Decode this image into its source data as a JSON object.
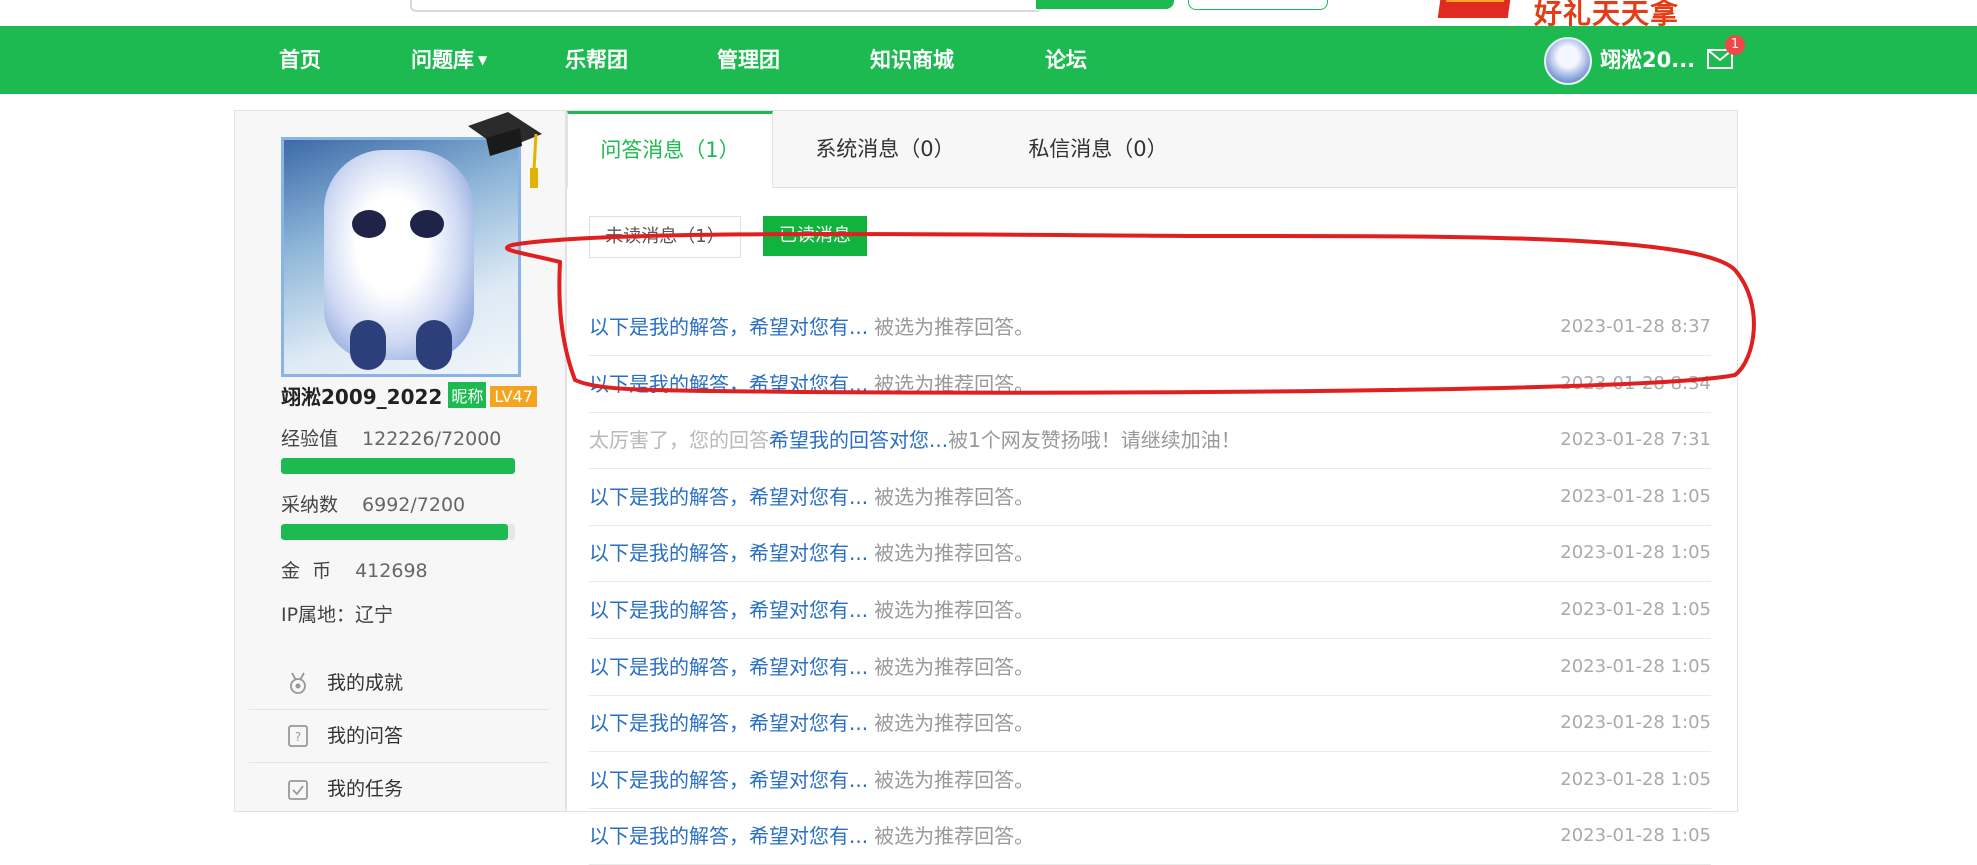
{
  "header": {
    "promo_text": "好礼天天拿"
  },
  "nav": {
    "items": [
      {
        "label": "首页"
      },
      {
        "label": "问题库"
      },
      {
        "label": "乐帮团"
      },
      {
        "label": "管理团"
      },
      {
        "label": "知识商城"
      },
      {
        "label": "论坛"
      }
    ],
    "user_name": "翊淞20...",
    "mail_badge": "1"
  },
  "profile": {
    "username": "翊淞2009_2022",
    "nickname_badge": "昵称",
    "level_badge": "LV47",
    "exp_label": "经验值",
    "exp_value": "122226/72000",
    "exp_progress": 1.0,
    "adopt_label": "采纳数",
    "adopt_value": "6992/7200",
    "adopt_progress": 0.971,
    "coin_label": "金  币",
    "coin_value": "412698",
    "ip_label": "IP属地：辽宁"
  },
  "sidebar_menu": [
    {
      "label": "我的成就",
      "icon": "medal-icon"
    },
    {
      "label": "我的问答",
      "icon": "qa-icon"
    },
    {
      "label": "我的任务",
      "icon": "task-icon"
    }
  ],
  "tabs": [
    {
      "label": "问答消息（1）"
    },
    {
      "label": "系统消息（0）"
    },
    {
      "label": "私信消息（0）"
    }
  ],
  "filters": {
    "unread": "未读消息（1）",
    "read": "已读消息"
  },
  "messages": [
    {
      "link": "以下是我的解答，希望对您有...",
      "text": "被选为推荐回答。",
      "time": "2023-01-28 8:37"
    },
    {
      "link": "以下是我的解答，希望对您有...",
      "text": "被选为推荐回答。",
      "time": "2023-01-28 8:34"
    },
    {
      "prefix": "太厉害了，您的回答",
      "link": "希望我的回答对您...",
      "text": "被1个网友赞扬哦！请继续加油！",
      "time": "2023-01-28 7:31"
    },
    {
      "link": "以下是我的解答，希望对您有...",
      "text": "被选为推荐回答。",
      "time": "2023-01-28 1:05"
    },
    {
      "link": "以下是我的解答，希望对您有...",
      "text": "被选为推荐回答。",
      "time": "2023-01-28 1:05"
    },
    {
      "link": "以下是我的解答，希望对您有...",
      "text": "被选为推荐回答。",
      "time": "2023-01-28 1:05"
    },
    {
      "link": "以下是我的解答，希望对您有...",
      "text": "被选为推荐回答。",
      "time": "2023-01-28 1:05"
    },
    {
      "link": "以下是我的解答，希望对您有...",
      "text": "被选为推荐回答。",
      "time": "2023-01-28 1:05"
    },
    {
      "link": "以下是我的解答，希望对您有...",
      "text": "被选为推荐回答。",
      "time": "2023-01-28 1:05"
    },
    {
      "link": "以下是我的解答，希望对您有...",
      "text": "被选为推荐回答。",
      "time": "2023-01-28 1:05"
    }
  ],
  "colors": {
    "brand_green": "#1dba51",
    "link_blue": "#2a6fc4",
    "annotation_red": "#e02020"
  }
}
